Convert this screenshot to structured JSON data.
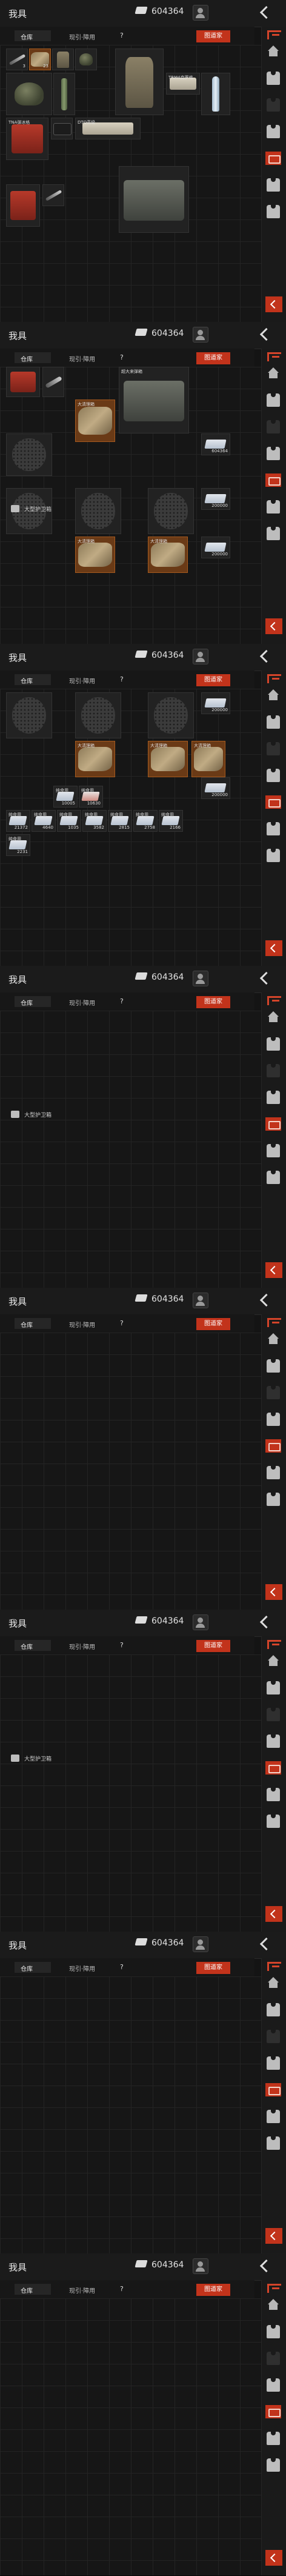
{
  "header": {
    "title": "我具",
    "money": "604364"
  },
  "tabs": {
    "tab1": "仓库",
    "tab2": "现引·障用",
    "help": "?",
    "sort": "图道家"
  },
  "sidebar": {
    "icons": [
      "home-icon",
      "vest-icon",
      "vest-icon",
      "vest-icon",
      "backpack-icon",
      "vest-icon",
      "vest-icon",
      "collapse-icon"
    ]
  },
  "panels": [
    {
      "cells": [
        {
          "label": "",
          "count": "3",
          "shape": "knife"
        },
        {
          "label": "",
          "count": "23",
          "shape": "blanket"
        },
        {
          "label": "",
          "count": "",
          "shape": "pack"
        },
        {
          "label": "",
          "count": "",
          "shape": "helmet"
        },
        {
          "label": "",
          "count": "",
          "shape": "helmet"
        },
        {
          "label": "",
          "count": "",
          "shape": "can"
        },
        {
          "label": "",
          "count": "",
          "shape": "pack"
        },
        {
          "label": "TRM4克罗格",
          "count": "",
          "shape": "box"
        },
        {
          "label": "",
          "count": "",
          "shape": "bottle"
        },
        {
          "label": "TNA弹冰格",
          "count": "",
          "shape": "redpack"
        },
        {
          "label": "",
          "count": "",
          "shape": "wallet"
        },
        {
          "label": "DTQ高级",
          "count": "",
          "shape": "box"
        },
        {
          "label": "",
          "count": "",
          "shape": "redpack"
        },
        {
          "label": "",
          "count": "",
          "shape": "knife"
        },
        {
          "label": "",
          "count": "",
          "shape": "case"
        }
      ],
      "crate": ""
    },
    {
      "cells": [
        {
          "label": "",
          "count": "",
          "shape": "redpack"
        },
        {
          "label": "",
          "count": "",
          "shape": "knife"
        },
        {
          "label": "超大来弹箱",
          "count": "",
          "shape": "case"
        },
        {
          "label": "",
          "count": "",
          "shape": "mesh"
        },
        {
          "label": "大清理箱",
          "count": "",
          "shape": "blanket"
        },
        {
          "label": "",
          "count": "604364",
          "shape": "cash"
        },
        {
          "label": "",
          "count": "",
          "shape": "mesh"
        },
        {
          "label": "",
          "count": "",
          "shape": "mesh"
        },
        {
          "label": "",
          "count": "",
          "shape": "mesh"
        },
        {
          "label": "",
          "count": "200000",
          "shape": "cash"
        },
        {
          "label": "大清理箱",
          "count": "",
          "shape": "blanket"
        },
        {
          "label": "大清理箱",
          "count": "",
          "shape": "blanket"
        },
        {
          "label": "",
          "count": "200000",
          "shape": "cash"
        }
      ],
      "crate": "大型护卫箱"
    },
    {
      "cells": [
        {
          "label": "",
          "count": "",
          "shape": "mesh"
        },
        {
          "label": "",
          "count": "",
          "shape": "mesh"
        },
        {
          "label": "",
          "count": "",
          "shape": "mesh"
        },
        {
          "label": "",
          "count": "200000",
          "shape": "cash"
        },
        {
          "label": "大清理箱",
          "count": "",
          "shape": "blanket"
        },
        {
          "label": "大清理箱",
          "count": "",
          "shape": "blanket"
        },
        {
          "label": "大清理箱",
          "count": "",
          "shape": "blanket"
        },
        {
          "label": "",
          "count": "200000",
          "shape": "cash"
        },
        {
          "label": "纯食用",
          "count": "10005",
          "shape": "cash"
        },
        {
          "label": "纯食用",
          "count": "10630",
          "shape": "cashred"
        },
        {
          "label": "纯食用",
          "count": "21372",
          "shape": "cash"
        },
        {
          "label": "纯食用",
          "count": "4640",
          "shape": "cash"
        },
        {
          "label": "纯食用",
          "count": "1035",
          "shape": "cash"
        },
        {
          "label": "纯食用",
          "count": "3582",
          "shape": "cash"
        },
        {
          "label": "纯食用",
          "count": "2815",
          "shape": "cash"
        },
        {
          "label": "纯食用",
          "count": "2758",
          "shape": "cash"
        },
        {
          "label": "纯食用",
          "count": "2166",
          "shape": "cash"
        },
        {
          "label": "纯食用",
          "count": "2231",
          "shape": "cash"
        }
      ],
      "crate": ""
    },
    {
      "cells": [],
      "crate": "大型护卫箱"
    },
    {
      "cells": [],
      "crate": ""
    },
    {
      "cells": [],
      "crate": "大型护卫箱"
    },
    {
      "cells": [],
      "crate": ""
    },
    {
      "cells": [],
      "crate": ""
    }
  ]
}
